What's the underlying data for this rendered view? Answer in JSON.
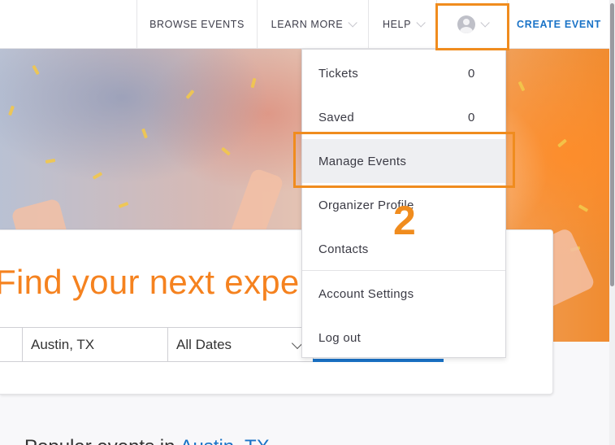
{
  "header": {
    "nav": {
      "browse_events": "BROWSE EVENTS",
      "learn_more": "LEARN MORE",
      "help": "HELP"
    },
    "create_event": "CREATE EVENT"
  },
  "user_menu": {
    "items": [
      {
        "label": "Tickets",
        "count": "0"
      },
      {
        "label": "Saved",
        "count": "0"
      },
      {
        "label": "Manage Events"
      },
      {
        "label": "Organizer Profile"
      },
      {
        "label": "Contacts"
      },
      {
        "label": "Account Settings"
      },
      {
        "label": "Log out"
      }
    ],
    "highlighted": "Manage Events"
  },
  "hero": {
    "headline": "Find your next experience"
  },
  "search": {
    "location": "Austin, TX",
    "dates": "All Dates"
  },
  "popular": {
    "prefix": "Popular events in",
    "location": "Austin, TX"
  },
  "tutorial": {
    "step": "2",
    "accent_color": "#f08c1e"
  },
  "colors": {
    "brand_orange": "#f5821f",
    "link_blue": "#1a73c7"
  }
}
